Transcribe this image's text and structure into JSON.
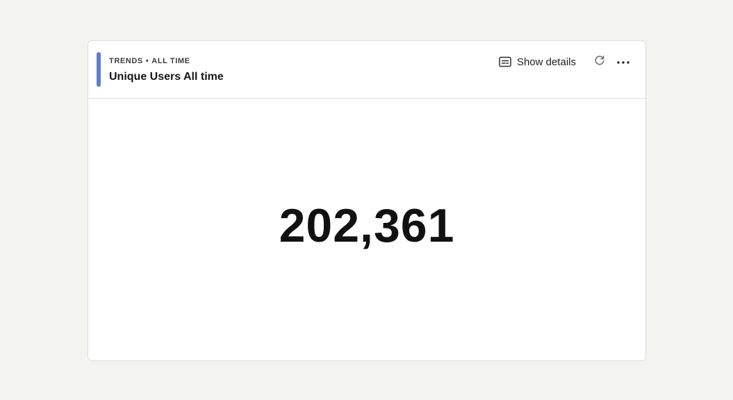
{
  "card": {
    "eyebrow_type": "TRENDS",
    "eyebrow_separator": "•",
    "eyebrow_range": "ALL TIME",
    "title": "Unique Users All time",
    "accent_color": "#5b7ecb",
    "actions": {
      "show_details_label": "Show details",
      "show_details_icon": "subtitles-icon",
      "refresh_icon": "refresh-icon",
      "more_icon": "more-horizontal-icon"
    },
    "value": "202,361"
  }
}
